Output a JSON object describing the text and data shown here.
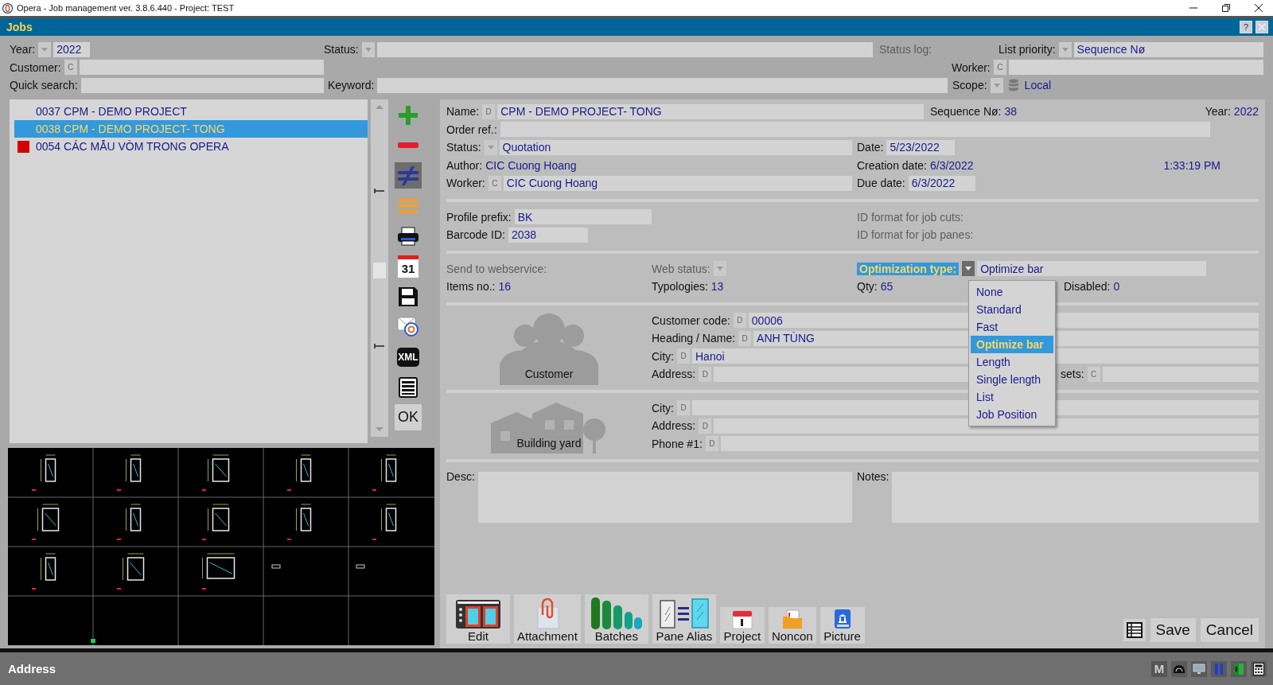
{
  "window": {
    "title": "Opera - Job management ver. 3.8.6.440 - Project: TEST"
  },
  "panel": {
    "title": "Jobs",
    "help": "?"
  },
  "filters": {
    "year": {
      "label": "Year:",
      "picker": true,
      "value": "2022",
      "kind": "input"
    },
    "status": {
      "label": "Status:",
      "picker": true,
      "kind": "input"
    },
    "status_log": {
      "label": "Status log:",
      "disabled": true
    },
    "list_priority": {
      "label": "List priority:",
      "picker": true,
      "value": "Sequence Nø",
      "kind": "input"
    },
    "customer": {
      "label": "Customer:",
      "tag": "C",
      "kind": "input"
    },
    "worker": {
      "label": "Worker:",
      "tag": "C",
      "kind": "input"
    },
    "quick_search": {
      "label": "Quick search:",
      "kind": "input"
    },
    "keyword": {
      "label": "Keyword:",
      "kind": "input"
    },
    "scope": {
      "label": "Scope:",
      "picker": true,
      "value": "Local",
      "kind": "source"
    }
  },
  "jobs": [
    {
      "text": "0037 CPM - DEMO PROJECT",
      "selected": false,
      "flagged": false
    },
    {
      "text": "0038 CPM - DEMO PROJECT- TONG",
      "selected": true,
      "flagged": false
    },
    {
      "text": "0054 CÁC MẪU VÒM TRONG OPERA",
      "selected": false,
      "flagged": true
    }
  ],
  "tools": [
    {
      "kind": "add",
      "selected": false
    },
    {
      "kind": "remove",
      "selected": false
    },
    {
      "kind": "compare",
      "selected": true
    },
    {
      "kind": "lines",
      "selected": false
    },
    {
      "kind": "print",
      "selected": false
    },
    {
      "kind": "calendar",
      "text": "31",
      "selected": false
    },
    {
      "kind": "save",
      "selected": false
    },
    {
      "kind": "mail",
      "selected": false
    },
    {
      "kind": "xml",
      "text": "XML",
      "selected": false
    },
    {
      "kind": "table",
      "selected": false
    },
    {
      "kind": "ok",
      "text": "OK",
      "selected": false
    }
  ],
  "form": {
    "name": {
      "label": "Name:",
      "tag": "D",
      "value": "CPM - DEMO PROJECT- TONG",
      "kind": "input"
    },
    "sequence": {
      "label": "Sequence Nø:",
      "value": "38",
      "kind": "text"
    },
    "year": {
      "label": "Year:",
      "value": "2022",
      "kind": "text"
    },
    "order_ref": {
      "label": "Order ref.:",
      "kind": "input"
    },
    "status": {
      "label": "Status:",
      "picker": true,
      "value": "Quotation",
      "kind": "input"
    },
    "date": {
      "label": "Date:",
      "value": "5/23/2022",
      "kind": "input"
    },
    "author": {
      "label": "Author:",
      "value": "CIC Cuong Hoang",
      "kind": "text"
    },
    "creation_date": {
      "label": "Creation date:",
      "value": "6/3/2022",
      "kind": "text"
    },
    "creation_time": "1:33:19 PM",
    "worker": {
      "label": "Worker:",
      "tag": "C",
      "value": "CIC Cuong Hoang",
      "kind": "input"
    },
    "due_date": {
      "label": "Due date:",
      "value": "6/3/2022",
      "kind": "input"
    },
    "profile_prefix": {
      "label": "Profile prefix:",
      "value": "BK",
      "kind": "input"
    },
    "barcode_id": {
      "label": "Barcode ID:",
      "value": "2038",
      "kind": "input"
    },
    "id_format_cuts": {
      "label": "ID format for job cuts:",
      "disabled": true
    },
    "id_format_panes": {
      "label": "ID format for job panes:",
      "disabled": true
    },
    "send_to_webservice": {
      "label": "Send to webservice:",
      "disabled": true
    },
    "web_status": {
      "label": "Web status:",
      "picker": true,
      "disabled": true
    },
    "optimization_type": {
      "label": "Optimization type:",
      "picker": true,
      "focused": true,
      "expanded": true,
      "value": "Optimize bar",
      "kind": "input",
      "options": [
        {
          "text": "None",
          "selected": false
        },
        {
          "text": "Standard",
          "selected": false
        },
        {
          "text": "Fast",
          "selected": false
        },
        {
          "text": "Optimize bar",
          "selected": true
        },
        {
          "text": "Length",
          "selected": false
        },
        {
          "text": "Single length",
          "selected": false
        },
        {
          "text": "List",
          "selected": false
        },
        {
          "text": "Job Position",
          "selected": false
        }
      ]
    },
    "items_no": {
      "label": "Items no.:",
      "value": "16",
      "kind": "text"
    },
    "typologies": {
      "label": "Typologies:",
      "value": "13",
      "kind": "text"
    },
    "qty": {
      "label": "Qty:",
      "value": "65",
      "kind": "text"
    },
    "disabled_count": {
      "label": "Disabled:",
      "value": "0",
      "kind": "text"
    },
    "customer": {
      "caption": "Customer",
      "fields": [
        {
          "label": "Customer code:",
          "tag": "D",
          "value": "00006",
          "kind": "input"
        },
        {
          "label": "Heading / Name:",
          "tag": "D",
          "value": "ANH TÙNG",
          "kind": "input"
        },
        {
          "label": "City:",
          "tag": "D",
          "value": "Hanoi",
          "kind": "input"
        },
        {
          "label": "Address:",
          "tag": "D",
          "kind": "input"
        }
      ],
      "extra": {
        "label": "sets:",
        "tag": "C",
        "kind": "input"
      }
    },
    "building_yard": {
      "caption": "Building yard",
      "fields": [
        {
          "label": "City:",
          "tag": "D",
          "kind": "input"
        },
        {
          "label": "Address:",
          "tag": "D",
          "kind": "input"
        },
        {
          "label": "Phone #1:",
          "tag": "D",
          "kind": "input"
        }
      ]
    },
    "desc": {
      "label": "Desc:",
      "kind": "input"
    },
    "notes": {
      "label": "Notes:",
      "kind": "input"
    }
  },
  "toolbar": [
    {
      "kind": "edit",
      "label": "Edit"
    },
    {
      "kind": "attachment",
      "label": "Attachment"
    },
    {
      "kind": "batches",
      "label": "Batches"
    },
    {
      "kind": "pane_alias",
      "label": "Pane Alias"
    },
    {
      "kind": "project",
      "label": "Project"
    },
    {
      "kind": "noncon",
      "label": "Noncon"
    },
    {
      "kind": "picture",
      "label": "Picture"
    }
  ],
  "actions": {
    "save": "Save",
    "cancel": "Cancel"
  },
  "status_bar": {
    "label": "Address",
    "icons": [
      {
        "kind": "m",
        "text": "M"
      },
      {
        "kind": "arch"
      },
      {
        "kind": "monitor"
      },
      {
        "kind": "pause"
      },
      {
        "kind": "document"
      },
      {
        "kind": "calculator"
      }
    ]
  }
}
